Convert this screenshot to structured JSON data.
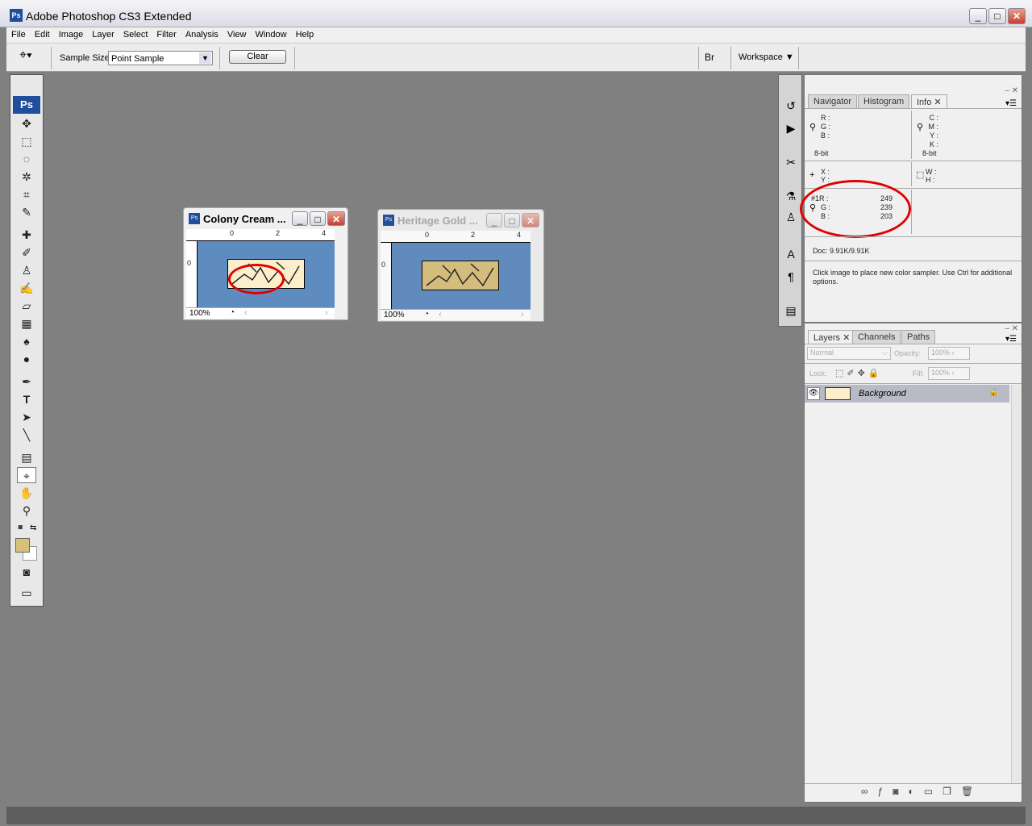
{
  "app": {
    "title": "Adobe Photoshop CS3 Extended",
    "logo": "Ps"
  },
  "menu": [
    "File",
    "Edit",
    "Image",
    "Layer",
    "Select",
    "Filter",
    "Analysis",
    "View",
    "Window",
    "Help"
  ],
  "options": {
    "sample_size_label": "Sample Size:",
    "sample_size_value": "Point Sample",
    "clear_label": "Clear",
    "workspace_label": "Workspace"
  },
  "toolbox": {
    "logo": "Ps",
    "foreground_color": "#d8c078",
    "background_color": "#ffffff"
  },
  "documents": [
    {
      "title": "Colony Cream ...",
      "zoom": "100%",
      "ruler_marks": [
        "0",
        "2",
        "4"
      ],
      "vruler": "0",
      "swatch_color": "#fbefcb",
      "active": true
    },
    {
      "title": "Heritage Gold ...",
      "zoom": "100%",
      "ruler_marks": [
        "0",
        "2",
        "4"
      ],
      "vruler": "0",
      "swatch_color": "#d8c07c",
      "active": false
    }
  ],
  "info_panel": {
    "tabs": [
      "Navigator",
      "Histogram",
      "Info"
    ],
    "active_tab": "Info",
    "rgb_labels": [
      "R :",
      "G :",
      "B :"
    ],
    "rgb_bits": "8-bit",
    "cmyk_labels": [
      "C :",
      "M :",
      "Y :",
      "K :"
    ],
    "cmyk_bits": "8-bit",
    "xy_labels": [
      "X :",
      "Y :"
    ],
    "wh_labels": [
      "W :",
      "H :"
    ],
    "sampler": {
      "labels": [
        "#1R :",
        "G :",
        "B :"
      ],
      "values": [
        "249",
        "239",
        "203"
      ]
    },
    "doc": "Doc: 9.91K/9.91K",
    "hint": "Click image to place new color sampler.  Use Ctrl for additional options."
  },
  "layers_panel": {
    "tabs": [
      "Layers",
      "Channels",
      "Paths"
    ],
    "blend_mode": "Normal",
    "opacity_label": "Opacity:",
    "opacity": "100%",
    "lock_label": "Lock:",
    "fill_label": "Fill:",
    "fill": "100%",
    "layers": [
      {
        "name": "Background",
        "visible": true,
        "locked": true
      }
    ]
  },
  "annotation_color": "#e00000"
}
